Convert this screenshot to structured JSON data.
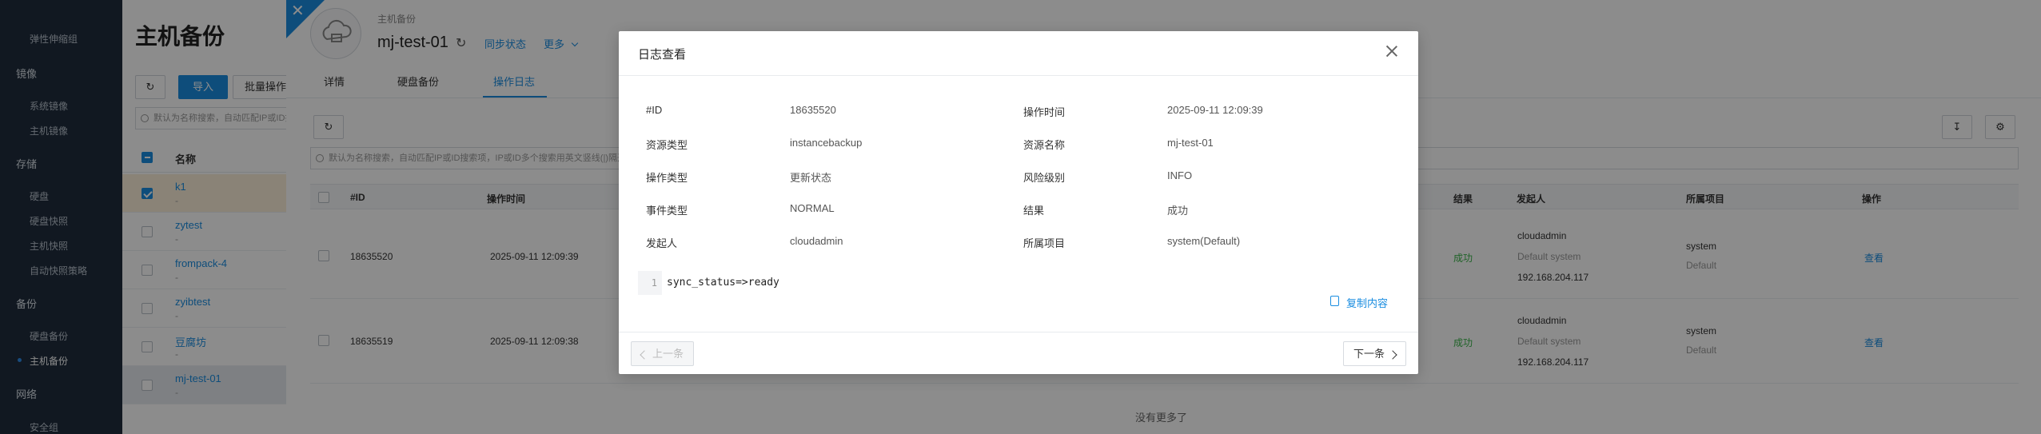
{
  "sidebar": {
    "groups": [
      {
        "label": "镜像",
        "items": [
          "系统镜像",
          "主机镜像"
        ]
      },
      {
        "label": "存储",
        "items": [
          "硬盘",
          "硬盘快照",
          "主机快照",
          "自动快照策略"
        ]
      },
      {
        "label": "备份",
        "items": [
          "硬盘备份",
          "主机备份"
        ]
      },
      {
        "label": "网络",
        "items": [
          "安全组"
        ]
      }
    ],
    "top_item": "弹性伸缩组",
    "active_item": "主机备份"
  },
  "list_page": {
    "title": "主机备份",
    "toolbar": {
      "import_label": "导入",
      "batch_label": "批量操作"
    },
    "search_placeholder": "默认为名称搜索，自动匹配IP或ID搜索项",
    "column_name": "名称",
    "rows": [
      {
        "name": "k1",
        "sub": "-"
      },
      {
        "name": "zytest",
        "sub": "-"
      },
      {
        "name": "frompack-4",
        "sub": "-"
      },
      {
        "name": "zyibtest",
        "sub": "-"
      },
      {
        "name": "豆腐坊",
        "sub": "-"
      },
      {
        "name": "mj-test-01",
        "sub": "-"
      }
    ]
  },
  "drawer": {
    "breadcrumb": "主机备份",
    "name": "mj-test-01",
    "actions": {
      "sync": "同步状态",
      "more": "更多"
    },
    "tabs": [
      "详情",
      "硬盘备份",
      "操作日志"
    ],
    "active_tab": "操作日志",
    "search_placeholder": "默认为名称搜索，自动匹配IP或ID搜索项，IP或ID多个搜索用英文竖线(|)隔开",
    "columns": [
      "#ID",
      "操作时间",
      "结果",
      "发起人",
      "所属项目",
      "操作"
    ],
    "rows": [
      {
        "id": "18635520",
        "time": "2025-09-11 12:09:39",
        "result": "成功",
        "user": "cloudadmin",
        "user_domain": "Default system",
        "ip": "192.168.204.117",
        "project": "system",
        "project_domain": "Default",
        "action": "查看"
      },
      {
        "id": "18635519",
        "time": "2025-09-11 12:09:38",
        "result": "成功",
        "user": "cloudadmin",
        "user_domain": "Default system",
        "ip": "192.168.204.117",
        "project": "system",
        "project_domain": "Default",
        "action": "查看"
      }
    ],
    "no_more": "没有更多了"
  },
  "modal": {
    "title": "日志查看",
    "fields": [
      {
        "label": "#ID",
        "value": "18635520"
      },
      {
        "label": "操作时间",
        "value": "2025-09-11 12:09:39"
      },
      {
        "label": "资源类型",
        "value": "instancebackup"
      },
      {
        "label": "资源名称",
        "value": "mj-test-01"
      },
      {
        "label": "操作类型",
        "value": "更新状态"
      },
      {
        "label": "风险级别",
        "value": "INFO"
      },
      {
        "label": "事件类型",
        "value": "NORMAL"
      },
      {
        "label": "结果",
        "value": "成功"
      },
      {
        "label": "发起人",
        "value": "cloudadmin"
      },
      {
        "label": "所属项目",
        "value": "system(Default)"
      }
    ],
    "code": {
      "line_number": "1",
      "text": "sync_status=>ready"
    },
    "copy_label": "复制内容",
    "prev_label": "上一条",
    "next_label": "下一条"
  }
}
